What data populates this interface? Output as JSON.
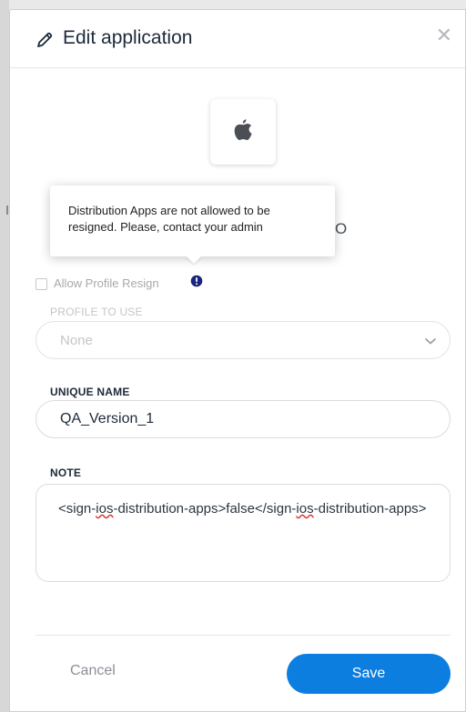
{
  "dialog": {
    "title": "Edit application",
    "close_glyph": "✕"
  },
  "app": {
    "platform_icon": "apple-icon",
    "partial_label": "O"
  },
  "tooltip": {
    "text": "Distribution Apps are not allowed to be resigned. Please, contact your admin"
  },
  "profile_resign": {
    "label": "Allow Profile Resign",
    "checked": false,
    "info_icon": "info-icon"
  },
  "profile_to_use": {
    "label": "PROFILE TO USE",
    "value": "None"
  },
  "unique_name": {
    "label": "UNIQUE NAME",
    "value": "QA_Version_1"
  },
  "note": {
    "label": "NOTE",
    "parts": [
      "<sign-",
      "ios",
      "-distribution-apps>false</sign-",
      "ios",
      "-distribution-apps>"
    ]
  },
  "footer": {
    "cancel_label": "Cancel",
    "save_label": "Save"
  },
  "colors": {
    "primary": "#0c7ee0",
    "title": "#1d2a3a",
    "disabled": "#c3c5c8",
    "info": "#1a237e"
  }
}
